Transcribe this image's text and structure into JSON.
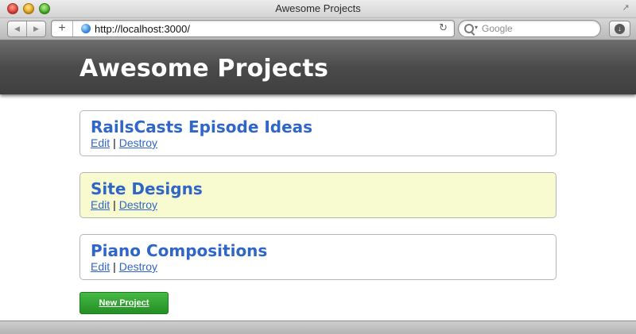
{
  "window": {
    "title": "Awesome Projects",
    "fullscreen_icon": "↗"
  },
  "toolbar": {
    "back_icon": "◀",
    "forward_icon": "▶",
    "plus_icon": "+",
    "url": "http://localhost:3000/",
    "reload_icon": "↻",
    "search_placeholder": "Google",
    "search_caret": "▾",
    "download_icon": "↓"
  },
  "page": {
    "site_title": "Awesome Projects",
    "projects": [
      {
        "title": "RailsCasts Episode Ideas",
        "edit_label": "Edit",
        "separator": "|",
        "destroy_label": "Destroy",
        "highlighted": false
      },
      {
        "title": "Site Designs",
        "edit_label": "Edit",
        "separator": "|",
        "destroy_label": "Destroy",
        "highlighted": true
      },
      {
        "title": "Piano Compositions",
        "edit_label": "Edit",
        "separator": "|",
        "destroy_label": "Destroy",
        "highlighted": false
      }
    ],
    "new_project_label": "New Project"
  },
  "colors": {
    "link": "#3066c8",
    "highlight_bg": "#f8fad0",
    "button_green": "#2fa12f",
    "header_bg": "#4a4a4a"
  }
}
